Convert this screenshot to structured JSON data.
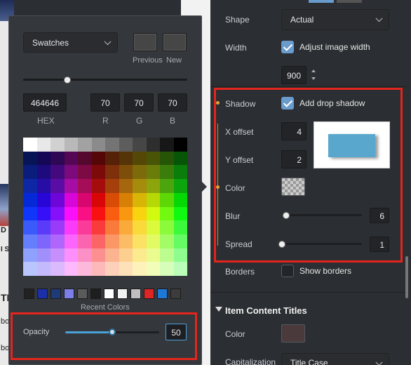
{
  "background_site": {
    "letters": [
      "TH",
      "bo",
      "bo",
      "D",
      "I S"
    ]
  },
  "picker": {
    "mode_dropdown": "Swatches",
    "previous_label": "Previous",
    "new_label": "New",
    "hex_value": "464646",
    "r_value": "70",
    "g_value": "70",
    "b_value": "70",
    "hex_label": "HEX",
    "r_label": "R",
    "g_label": "G",
    "b_label": "B",
    "recent_label": "Recent Colors",
    "recent_colors": [
      "#222222",
      "#1a2fa8",
      "#1e3a78",
      "#7c7ee8",
      "#5a5a5a",
      "#1e1e1e",
      "#ffffff",
      "#f2f2f2",
      "#bfbfbf",
      "#e02525",
      "#1e78d6",
      "#3c3c3c"
    ],
    "opacity_label": "Opacity",
    "opacity_value": "50",
    "opacity_level": 0.5,
    "accent_color": "#e3251d"
  },
  "panel": {
    "shape_label": "Shape",
    "shape_value": "Actual",
    "width_label": "Width",
    "adjust_width_label": "Adjust image width",
    "width_value": "900",
    "shadow_label": "Shadow",
    "add_shadow_label": "Add drop shadow",
    "x_offset_label": "X offset",
    "x_offset_value": "4",
    "y_offset_label": "Y offset",
    "y_offset_value": "2",
    "color_label": "Color",
    "blur_label": "Blur",
    "blur_value": "6",
    "spread_label": "Spread",
    "spread_value": "1",
    "borders_label": "Borders",
    "show_borders_label": "Show borders",
    "section_title": "Item Content Titles",
    "section_color_label": "Color",
    "capitalization_label": "Capitalization",
    "capitalization_value": "Title Case",
    "shadow_preview_color": "#5aa7cd"
  }
}
